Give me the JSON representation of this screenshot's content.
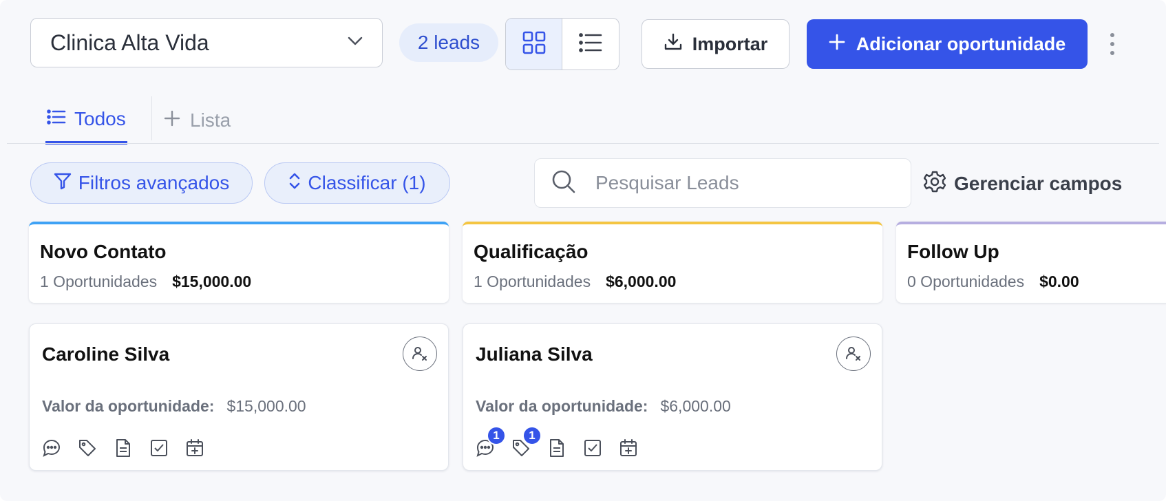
{
  "header": {
    "pipeline": {
      "value": "Clinica Alta Vida"
    },
    "leads_count": "2 leads",
    "import_label": "Importar",
    "add_label": "Adicionar oportunidade"
  },
  "tabs": [
    {
      "label": "Todos"
    },
    {
      "label": "Lista"
    }
  ],
  "toolbar": {
    "filters_label": "Filtros avançados",
    "sort_label": "Classificar (1)",
    "search_placeholder": "Pesquisar Leads",
    "manage_fields_label": "Gerenciar campos"
  },
  "stages": [
    {
      "name": "Novo Contato",
      "count": "1 Oportunidades",
      "amount": "$15,000.00",
      "color": "#3ea2f5"
    },
    {
      "name": "Qualificação",
      "count": "1 Oportunidades",
      "amount": "$6,000.00",
      "color": "#f4c542"
    },
    {
      "name": "Follow Up",
      "count": "0 Oportunidades",
      "amount": "$0.00",
      "color": "#b6aee0"
    }
  ],
  "cards": [
    {
      "name": "Caroline Silva",
      "value_label": "Valor da oportunidade:",
      "value": "$15,000.00",
      "badges": {
        "conversations": "",
        "tags": ""
      }
    },
    {
      "name": "Juliana Silva",
      "value_label": "Valor da oportunidade:",
      "value": "$6,000.00",
      "badges": {
        "conversations": "1",
        "tags": "1"
      }
    }
  ],
  "colors": {
    "accent": "#3554e8",
    "accent_bg": "#e9effb",
    "background": "#f7f8fb"
  },
  "icons": [
    "chevron-down-icon",
    "grid-view-icon",
    "list-view-icon",
    "download-icon",
    "plus-icon",
    "kebab-menu-icon",
    "list-icon",
    "filter-icon",
    "sort-icon",
    "search-icon",
    "gear-icon",
    "unassigned-user-icon",
    "chat-icon",
    "tag-icon",
    "note-icon",
    "task-icon",
    "calendar-add-icon"
  ]
}
